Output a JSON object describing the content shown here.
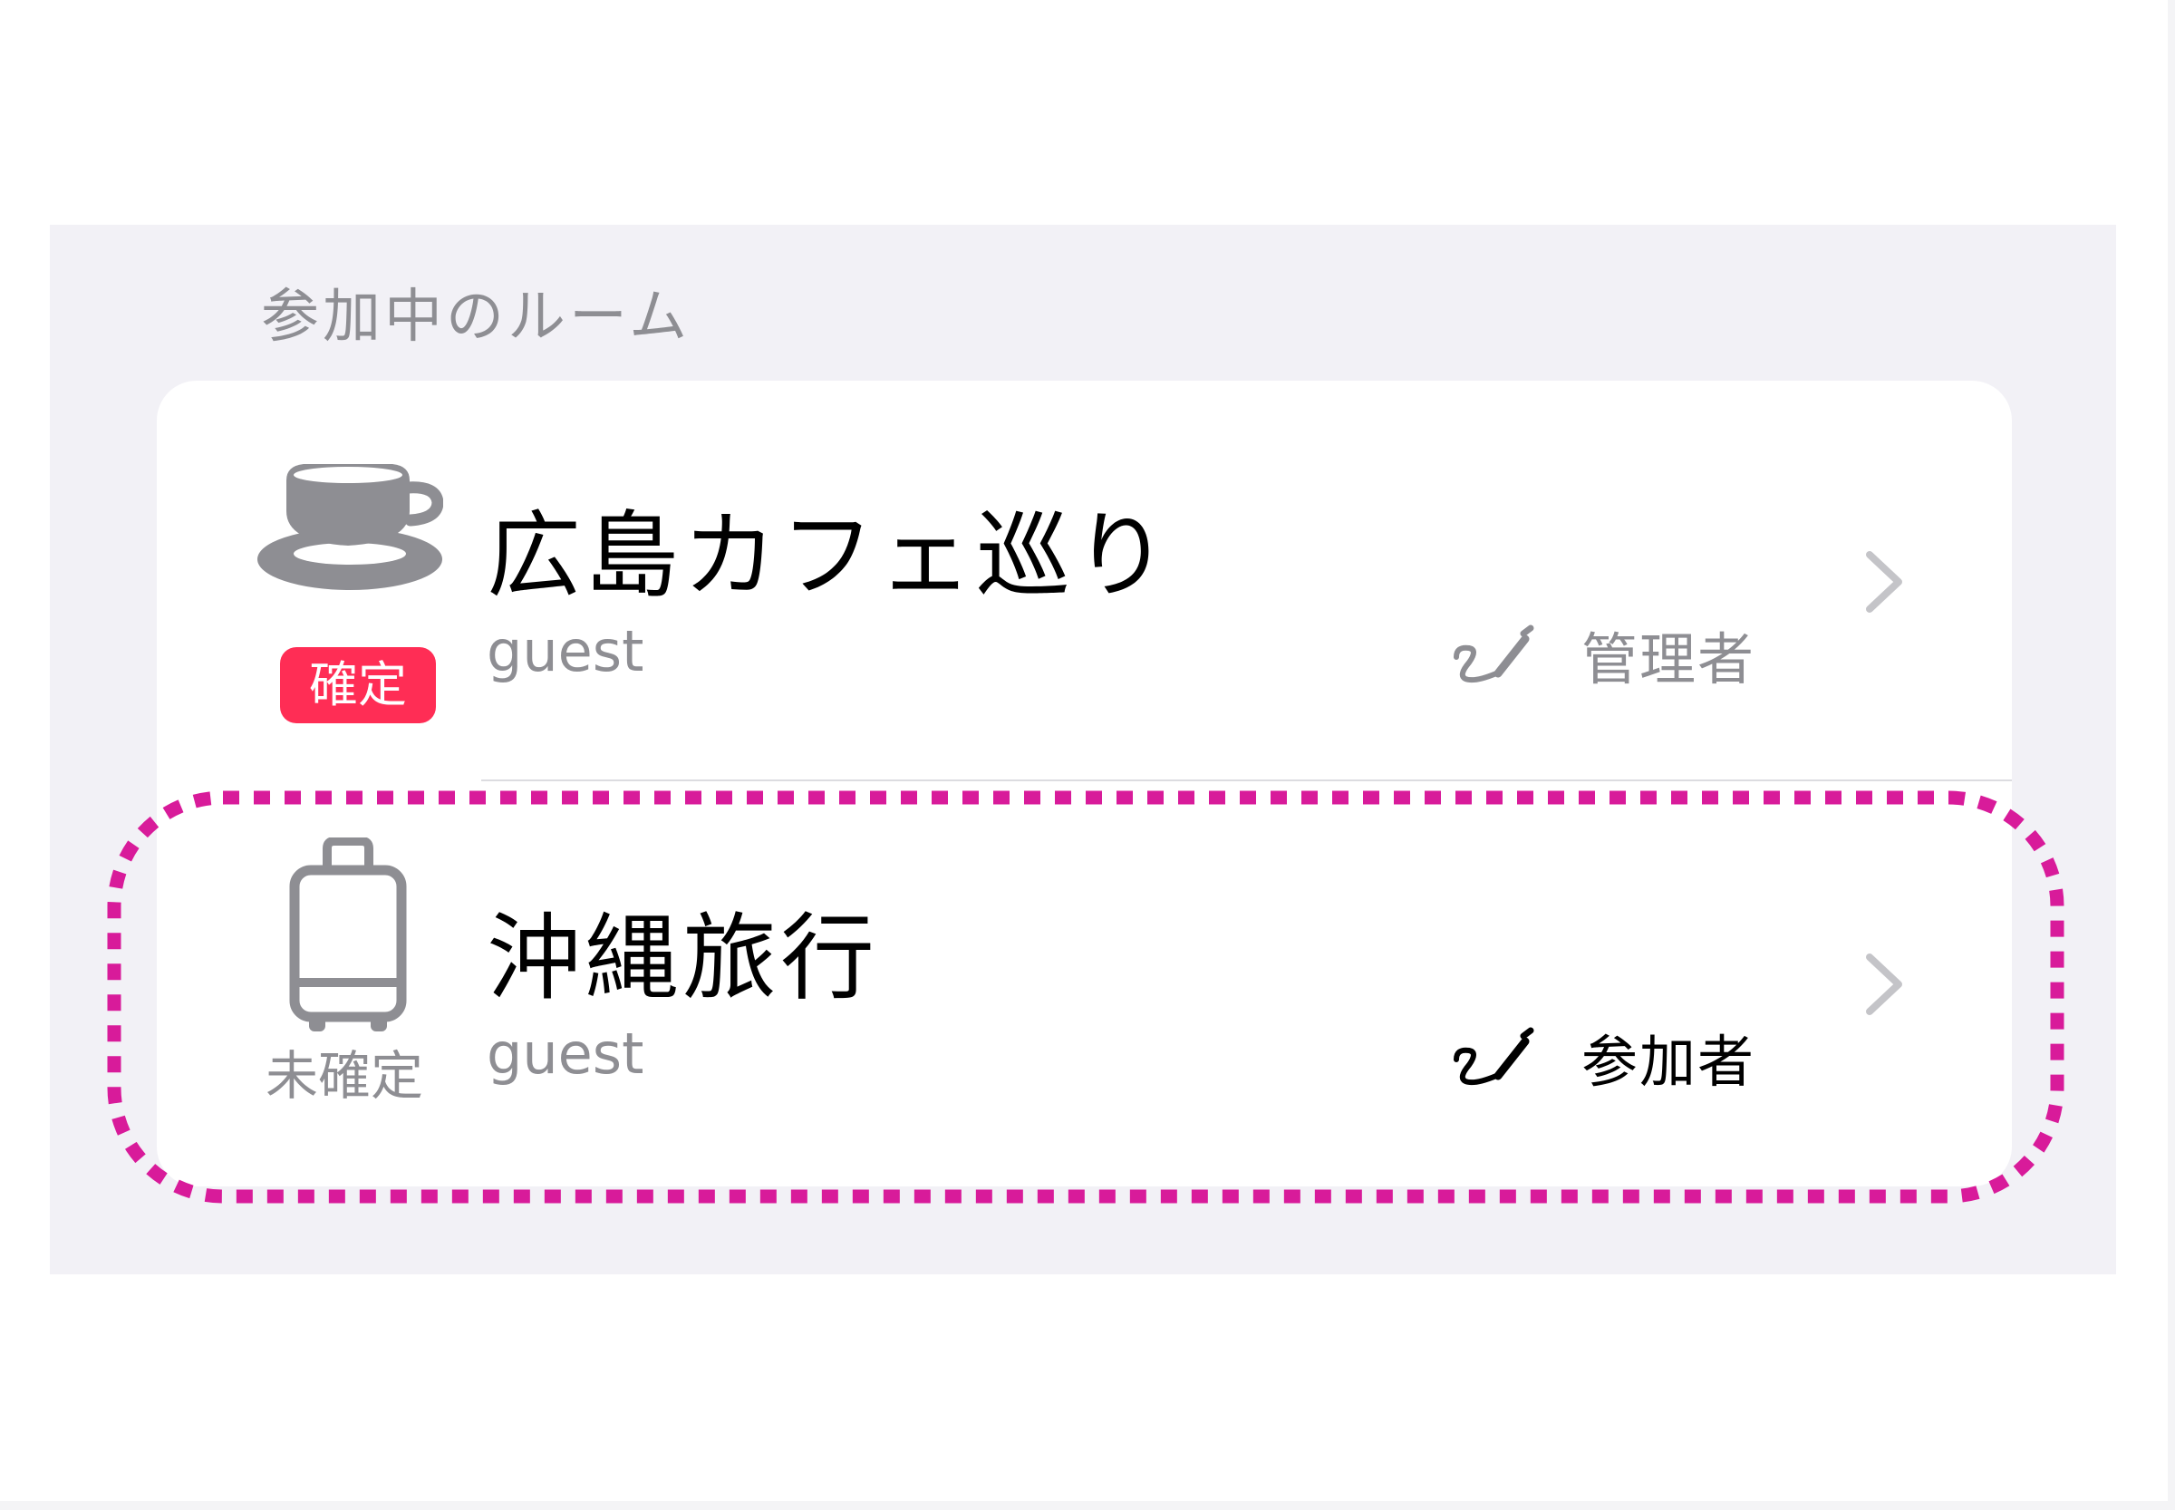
{
  "section_title": "参加中のルーム",
  "rooms": [
    {
      "title": "広島カフェ巡り",
      "user": "guest",
      "status": "確定",
      "role": "管理者",
      "icon": "coffee-cup-icon"
    },
    {
      "title": "沖縄旅行",
      "user": "guest",
      "status": "未確定",
      "role": "参加者",
      "icon": "suitcase-icon"
    }
  ],
  "colors": {
    "background": "#f2f1f6",
    "card": "#ffffff",
    "confirmed_badge": "#ff2d55",
    "secondary_text": "#8e8e93",
    "icon_gray": "#8e8e93",
    "highlight": "#d81b9a"
  }
}
